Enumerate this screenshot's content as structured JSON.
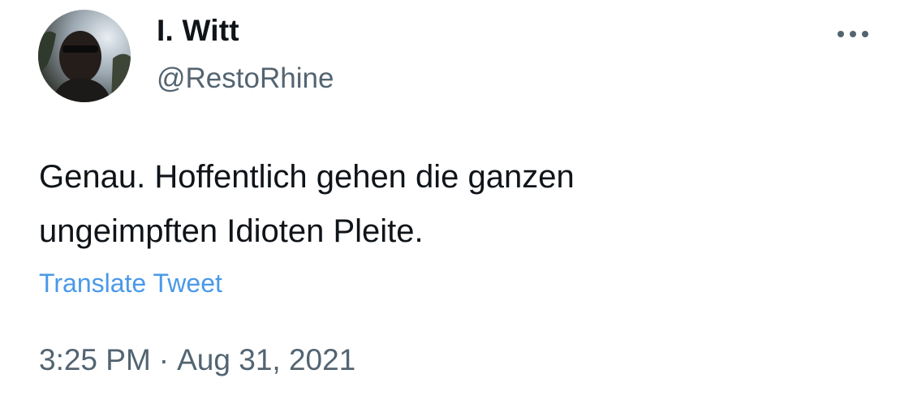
{
  "user": {
    "display_name": "I. Witt",
    "handle": "@RestoRhine",
    "avatar_icon": "avatar-photo"
  },
  "tweet": {
    "text_lines": [
      "Genau. Hoffentlich gehen die ganzen",
      "ungeimpften Idioten Pleite."
    ],
    "translate_label": "Translate Tweet",
    "time": "3:25 PM",
    "separator": "·",
    "date": "Aug 31, 2021"
  },
  "menu": {
    "icon": "more-horizontal-icon"
  },
  "colors": {
    "text": "#0f1419",
    "secondary": "#536471",
    "link": "#4a99e9",
    "background": "#ffffff"
  }
}
